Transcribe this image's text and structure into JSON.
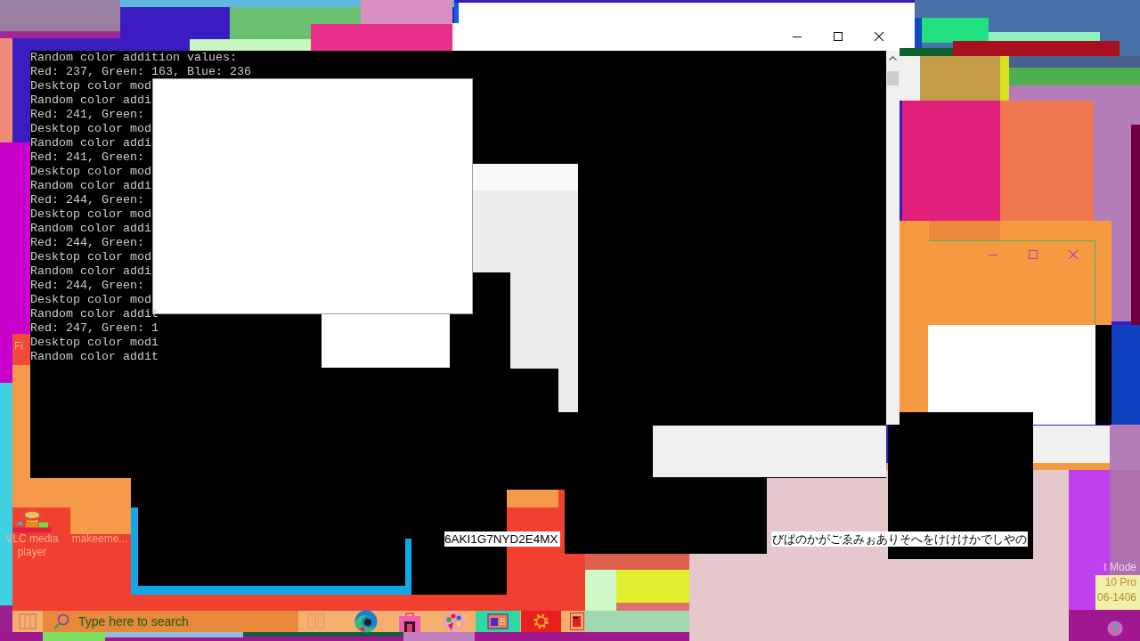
{
  "console_window": {
    "lines": [
      "Random color addition values:",
      "Red: 237, Green: 163, Blue: 236",
      "Desktop color mod",
      "Random color addi",
      "Red: 241, Green:",
      "Desktop color mod",
      "Random color addi",
      "Red: 241, Green:",
      "Desktop color mod",
      "Random color addi",
      "Red: 244, Green:",
      "Desktop color mod",
      "Random color addi",
      "Red: 244, Green:",
      "Desktop color mod",
      "Random color addi",
      "Red: 244, Green:",
      "Desktop color mod",
      "Random color addit",
      "Red: 247, Green: 1",
      "Desktop color modi",
      "Random color addit"
    ]
  },
  "overlay_texts": [
    "6AKI1G7NYD2E4MX",
    "びぱのかがごゑみぉありそへをけけけかでしやの"
  ],
  "desktop_icons": [
    {
      "label": "Fi",
      "kind": "label-only"
    },
    {
      "label": "VLC media player",
      "kind": "cone"
    },
    {
      "label": "makeeme...",
      "kind": "label-only"
    }
  ],
  "taskbar": {
    "search": {
      "placeholder": "Type here to search"
    }
  },
  "watermark": {
    "lines": [
      "t Mode",
      "10 Pro",
      "06-1406"
    ]
  }
}
